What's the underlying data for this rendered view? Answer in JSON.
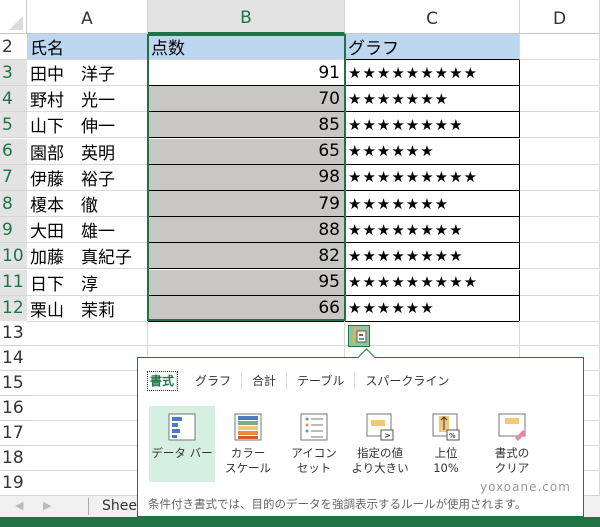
{
  "columns": [
    "A",
    "B",
    "C",
    "D"
  ],
  "header_row": {
    "row": "2",
    "name": "氏名",
    "score": "点数",
    "graph": "グラフ"
  },
  "rows": [
    {
      "row": "3",
      "name": "田中　洋子",
      "score": "91",
      "stars": "★★★★★★★★★"
    },
    {
      "row": "4",
      "name": "野村　光一",
      "score": "70",
      "stars": "★★★★★★★"
    },
    {
      "row": "5",
      "name": "山下　伸一",
      "score": "85",
      "stars": "★★★★★★★★"
    },
    {
      "row": "6",
      "name": "園部　英明",
      "score": "65",
      "stars": "★★★★★★"
    },
    {
      "row": "7",
      "name": "伊藤　裕子",
      "score": "98",
      "stars": "★★★★★★★★★"
    },
    {
      "row": "8",
      "name": "榎本　徹",
      "score": "79",
      "stars": "★★★★★★★"
    },
    {
      "row": "9",
      "name": "大田　雄一",
      "score": "88",
      "stars": "★★★★★★★★"
    },
    {
      "row": "10",
      "name": "加藤　真紀子",
      "score": "82",
      "stars": "★★★★★★★★"
    },
    {
      "row": "11",
      "name": "日下　淳",
      "score": "95",
      "stars": "★★★★★★★★★"
    },
    {
      "row": "12",
      "name": "栗山　茉莉",
      "score": "66",
      "stars": "★★★★★★"
    }
  ],
  "empty_rows": [
    "13",
    "14",
    "15",
    "16",
    "17",
    "18",
    "19"
  ],
  "quick_analysis": {
    "tabs": [
      "書式",
      "グラフ",
      "合計",
      "テーブル",
      "スパークライン"
    ],
    "options": [
      {
        "label": "データ バー",
        "icon": "data-bar-icon"
      },
      {
        "label": "カラー\nスケール",
        "icon": "color-scale-icon"
      },
      {
        "label": "アイコン\nセット",
        "icon": "icon-set-icon"
      },
      {
        "label": "指定の値\nより大きい",
        "icon": "greater-than-icon"
      },
      {
        "label": "上位\n10%",
        "icon": "top-10-icon"
      },
      {
        "label": "書式の\nクリア",
        "icon": "clear-format-icon"
      }
    ],
    "footer": "条件付き書式では、目的のデータを強調表示するルールが使用されます。"
  },
  "sheet_tab": "Sheet",
  "watermark": "yoxoane.com",
  "colors": {
    "accent": "#217346",
    "header_fill": "#bdd7ee",
    "data_bar": "#c9c7c3"
  }
}
